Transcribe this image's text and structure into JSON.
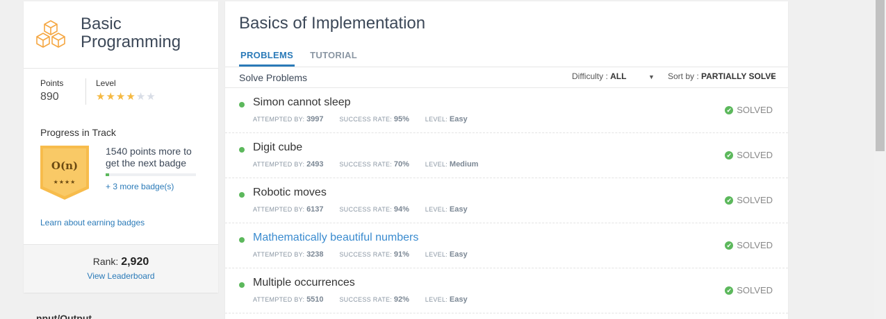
{
  "track": {
    "title": "Basic Programming",
    "points_label": "Points",
    "points_value": "890",
    "level_label": "Level",
    "level_stars": 4,
    "level_max": 6,
    "progress_title": "Progress in Track",
    "badge_text": "O(n)",
    "badge_stars": "★★★★",
    "next_badge_text": "1540 points more to get the next badge",
    "progress_fraction": 0.04,
    "more_badges": "+ 3 more badge(s)",
    "learn_link": "Learn about earning badges",
    "rank_label": "Rank:",
    "rank_value": "2,920",
    "leaderboard_link": "View Leaderboard",
    "partial_below": "nput/Output"
  },
  "main": {
    "title": "Basics of Implementation",
    "tabs": [
      {
        "label": "PROBLEMS",
        "active": true
      },
      {
        "label": "TUTORIAL",
        "active": false
      }
    ],
    "subbar_title": "Solve Problems",
    "difficulty_label": "Difficulty :",
    "difficulty_value": "ALL",
    "sort_label": "Sort by :",
    "sort_value": "PARTIALLY SOLVED",
    "meta_labels": {
      "attempted": "ATTEMPTED BY:",
      "success": "SUCCESS RATE:",
      "level": "LEVEL:"
    },
    "problems": [
      {
        "name": "Simon cannot sleep",
        "attempted": "3997",
        "success": "95%",
        "level": "Easy",
        "status": "SOLVED",
        "highlighted": false
      },
      {
        "name": "Digit cube",
        "attempted": "2493",
        "success": "70%",
        "level": "Medium",
        "status": "SOLVED",
        "highlighted": false
      },
      {
        "name": "Robotic moves",
        "attempted": "6137",
        "success": "94%",
        "level": "Easy",
        "status": "SOLVED",
        "highlighted": false
      },
      {
        "name": "Mathematically beautiful numbers",
        "attempted": "3238",
        "success": "91%",
        "level": "Easy",
        "status": "SOLVED",
        "highlighted": true
      },
      {
        "name": "Multiple occurrences",
        "attempted": "5510",
        "success": "92%",
        "level": "Easy",
        "status": "SOLVED",
        "highlighted": false
      }
    ]
  },
  "colors": {
    "accent": "#2a7ab8",
    "solved_green": "#5cb85c",
    "star": "#f5b942",
    "badge_gold": "#f7bc4c"
  },
  "icons": {
    "track": "cubes-icon",
    "solved": "check-circle-icon",
    "dot": "status-dot-icon"
  }
}
